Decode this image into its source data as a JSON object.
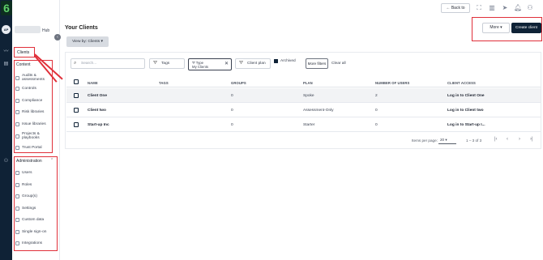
{
  "rail": {
    "logo": "6",
    "avatar_initials": "AP"
  },
  "sidebar": {
    "hub_label": "Hub",
    "clients_label": "Clients",
    "content_header": "Content",
    "content_items": [
      {
        "label": "Audits & assessments",
        "icon": "clipboard-icon"
      },
      {
        "label": "Controls",
        "icon": "document-icon"
      },
      {
        "label": "Compliance",
        "icon": "key-icon"
      },
      {
        "label": "Risk libraries",
        "icon": "list-icon"
      },
      {
        "label": "Issue libraries",
        "icon": "flag-icon"
      },
      {
        "label": "Projects & playbooks",
        "icon": "folder-icon"
      },
      {
        "label": "Trust Portal",
        "icon": "shield-icon"
      }
    ],
    "admin_header": "Administration",
    "admin_items": [
      {
        "label": "Users",
        "icon": "user-icon"
      },
      {
        "label": "Roles",
        "icon": "roles-icon"
      },
      {
        "label": "Group(s)",
        "icon": "group-icon"
      },
      {
        "label": "Settings",
        "icon": "gear-icon"
      },
      {
        "label": "Custom data",
        "icon": "database-icon"
      },
      {
        "label": "Single sign-on",
        "icon": "sso-icon"
      },
      {
        "label": "Integrations",
        "icon": "integrations-icon"
      }
    ]
  },
  "topbar": {
    "back_label": "Back to"
  },
  "main": {
    "title": "Your Clients",
    "view_by": "View by: Clients",
    "more_label": "More",
    "create_label": "Create client",
    "search_placeholder": "Search...",
    "filters": {
      "tags": "Tags",
      "type_label": "Type",
      "type_value": "My Clients",
      "client_plan": "Client plan",
      "archived": "Archived",
      "more_filters": "More filters",
      "clear_all": "Clear all"
    },
    "columns": [
      "NAME",
      "TAGS",
      "GROUPS",
      "PLAN",
      "NUMBER OF USERS",
      "CLIENT ACCESS"
    ],
    "rows": [
      {
        "name": "Client One",
        "tags": "",
        "groups": "0",
        "plan": "Spoke",
        "users": "2",
        "access": "Log in to Client One"
      },
      {
        "name": "Client two",
        "tags": "",
        "groups": "0",
        "plan": "Assessment-Only",
        "users": "0",
        "access": "Log in to Client two"
      },
      {
        "name": "Start-up Inc",
        "tags": "",
        "groups": "0",
        "plan": "Starter",
        "users": "0",
        "access": "Log in to Start-up I..."
      }
    ],
    "pagination": {
      "items_per_page_label": "Items per page:",
      "per_page": "20",
      "range": "1 – 3 of 3"
    }
  },
  "colors": {
    "accent": "#0f2236",
    "highlight": "#e0303a",
    "logo_green": "#5fd06a"
  }
}
